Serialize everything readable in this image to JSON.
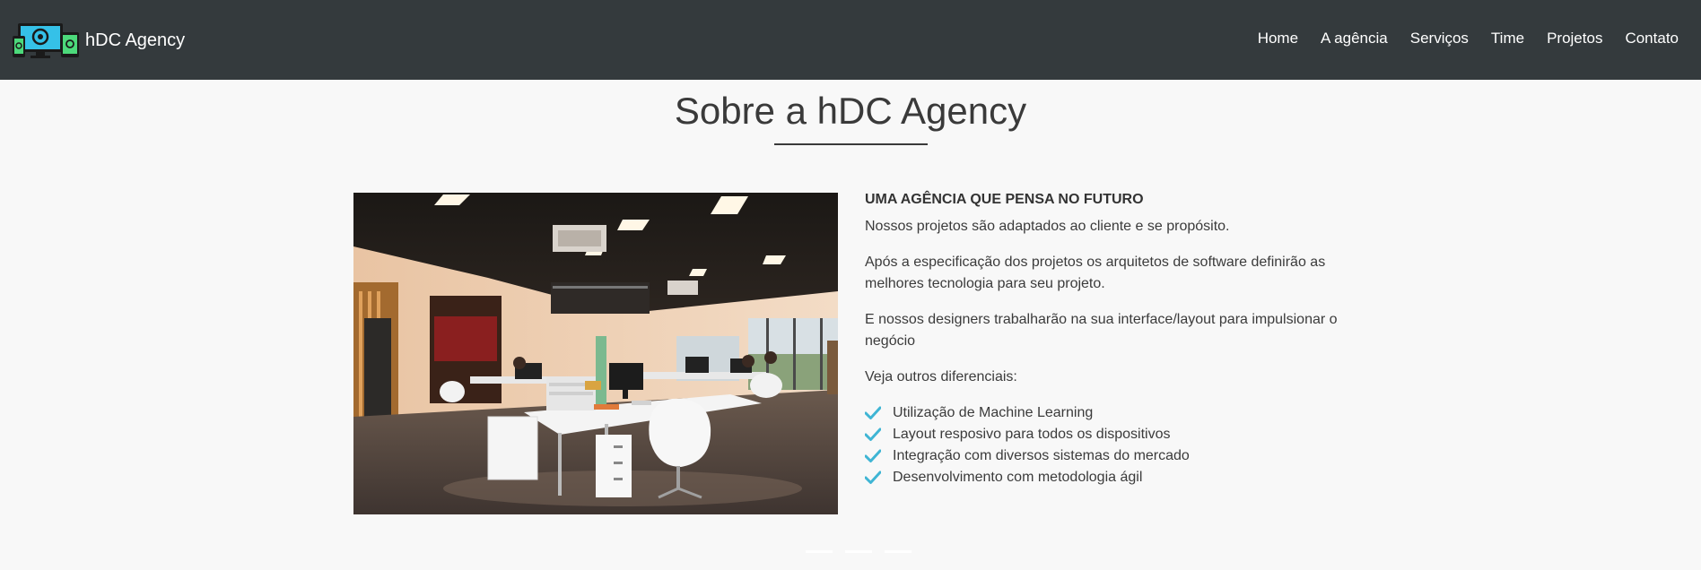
{
  "brand": {
    "name": "hDC Agency",
    "logo_icon": "devices-logo-icon"
  },
  "nav": {
    "items": [
      "Home",
      "A agência",
      "Serviços",
      "Time",
      "Projetos",
      "Contato"
    ]
  },
  "about": {
    "title": "Sobre a hDC Agency",
    "heading": "UMA AGÊNCIA QUE PENSA NO FUTURO",
    "paragraphs": [
      "Nossos projetos são adaptados ao cliente e se propósito.",
      "Após a especificação dos projetos os arquitetos de software definirão as melhores tecnologia para seu projeto.",
      "E nossos designers trabalharão na sua interface/layout para impulsionar o negócio",
      "Veja outros diferenciais:"
    ],
    "features": [
      "Utilização de Machine Learning",
      "Layout resposivo para todos os dispositivos",
      "Integração com diversos sistemas do mercado",
      "Desenvolvimento com metodologia ágil"
    ],
    "check_icon": "check-icon",
    "check_color": "#3fb5d4"
  },
  "colors": {
    "navbar_bg": "#343a3d",
    "page_bg": "#f8f8f8",
    "accent": "#3fb5d4"
  }
}
